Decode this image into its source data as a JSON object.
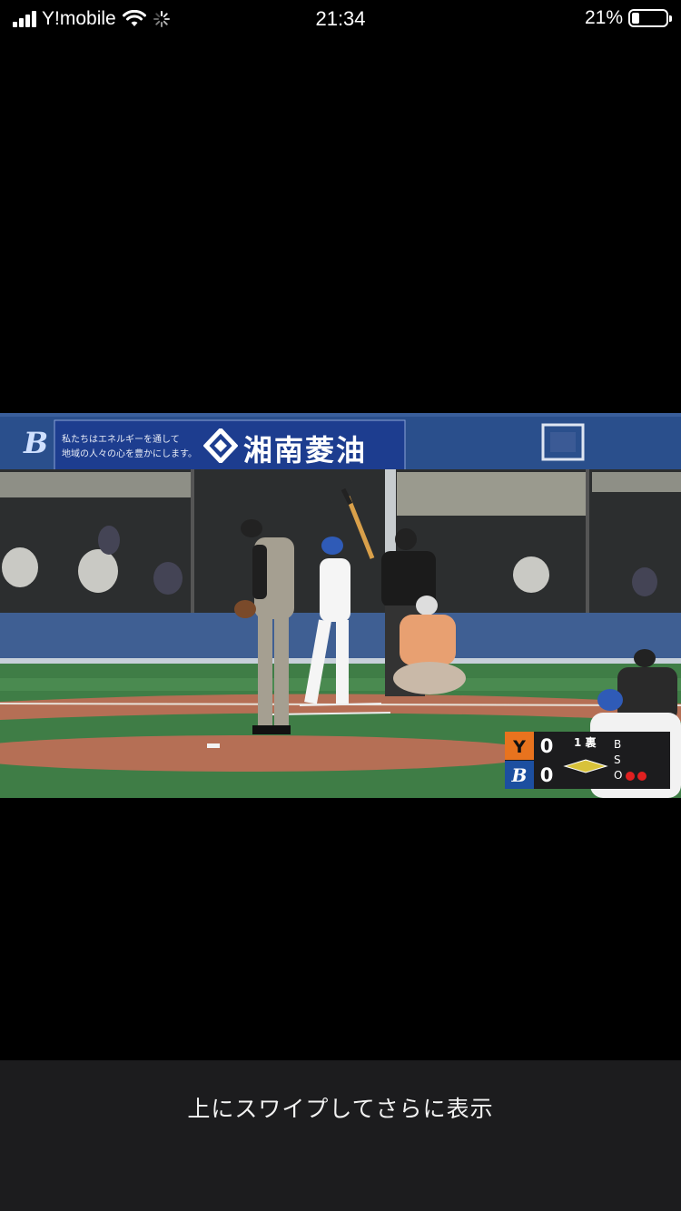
{
  "status_bar": {
    "carrier": "Y!mobile",
    "time": "21:34",
    "battery_percent": "21%",
    "battery_level": 0.21,
    "icons": [
      "signal-icon",
      "wifi-icon",
      "activity-spinner-icon",
      "battery-icon"
    ]
  },
  "video": {
    "banner_text": "湘南菱油",
    "banner_subtext_line1": "私たちはエネルギーを通して",
    "banner_subtext_line2": "地域の人々の心を豊かにします。",
    "team_logo_letter": "B",
    "scoreboard": {
      "away_score": "0",
      "home_score": "0",
      "away_logo_color": "#e8731e",
      "home_logo_color": "#1c4fa0",
      "inning": "1 裏",
      "ball_label": "B",
      "strike_label": "S",
      "out_label": "O",
      "outs": 2
    }
  },
  "bottom": {
    "swipe_hint": "上にスワイプしてさらに表示"
  },
  "colors": {
    "background": "#000000",
    "panel": "#1c1c1e",
    "banner_blue": "#1d3d8f",
    "field_green": "#3f7d46",
    "dirt": "#b56f55"
  }
}
